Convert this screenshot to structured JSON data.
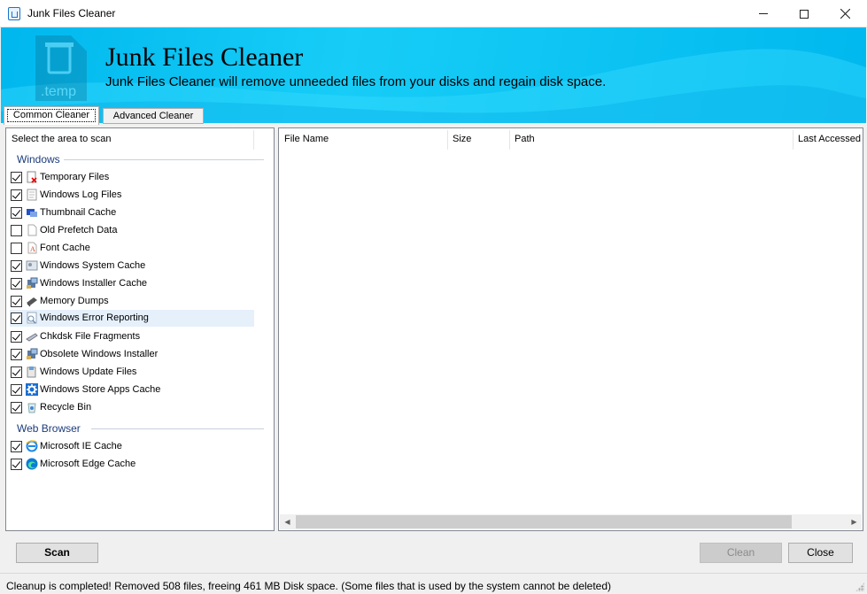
{
  "window": {
    "title": "Junk Files Cleaner",
    "minimize_label": "–",
    "close_label": "✕"
  },
  "banner": {
    "title": "Junk Files Cleaner",
    "subtitle": "Junk Files Cleaner will remove unneeded files from your disks and regain disk space.",
    "logo_text": ".temp"
  },
  "tabs": [
    {
      "label": "Common Cleaner",
      "selected": true
    },
    {
      "label": "Advanced Cleaner",
      "selected": false
    }
  ],
  "left_pane": {
    "header": "Select the area to scan",
    "groups": [
      {
        "label": "Windows",
        "items": [
          {
            "label": "Temporary Files",
            "checked": true,
            "icon": "temp-files-icon"
          },
          {
            "label": "Windows Log Files",
            "checked": true,
            "icon": "log-file-icon"
          },
          {
            "label": "Thumbnail Cache",
            "checked": true,
            "icon": "thumbnail-icon"
          },
          {
            "label": "Old Prefetch Data",
            "checked": false,
            "icon": "blank-file-icon"
          },
          {
            "label": "Font Cache",
            "checked": false,
            "icon": "font-icon"
          },
          {
            "label": "Windows System Cache",
            "checked": true,
            "icon": "system-cache-icon"
          },
          {
            "label": "Windows Installer Cache",
            "checked": true,
            "icon": "installer-icon"
          },
          {
            "label": "Memory Dumps",
            "checked": true,
            "icon": "memory-chip-icon"
          },
          {
            "label": "Windows Error Reporting",
            "checked": true,
            "icon": "error-report-icon",
            "highlighted": true
          },
          {
            "label": "Chkdsk File Fragments",
            "checked": true,
            "icon": "disk-fragments-icon"
          },
          {
            "label": "Obsolete Windows Installer",
            "checked": true,
            "icon": "installer-icon"
          },
          {
            "label": "Windows Update Files",
            "checked": true,
            "icon": "update-icon"
          },
          {
            "label": "Windows Store Apps Cache",
            "checked": true,
            "icon": "gear-icon"
          },
          {
            "label": "Recycle Bin",
            "checked": true,
            "icon": "recycle-bin-icon"
          }
        ]
      },
      {
        "label": "Web Browser",
        "items": [
          {
            "label": "Microsoft IE Cache",
            "checked": true,
            "icon": "ie-icon"
          },
          {
            "label": "Microsoft Edge Cache",
            "checked": true,
            "icon": "edge-icon"
          }
        ]
      }
    ]
  },
  "file_list": {
    "columns": [
      "File Name",
      "Size",
      "Path",
      "Last Accessed"
    ],
    "rows": []
  },
  "buttons": {
    "scan": "Scan",
    "clean": "Clean",
    "close": "Close"
  },
  "status_text": "Cleanup is completed!  Removed 508 files, freeing 461 MB Disk space. (Some files that is used by the system cannot be deleted)",
  "colors": {
    "banner": "#17cdf7",
    "group_label": "#1c3c7c",
    "highlight_row": "#e5f0fb"
  }
}
